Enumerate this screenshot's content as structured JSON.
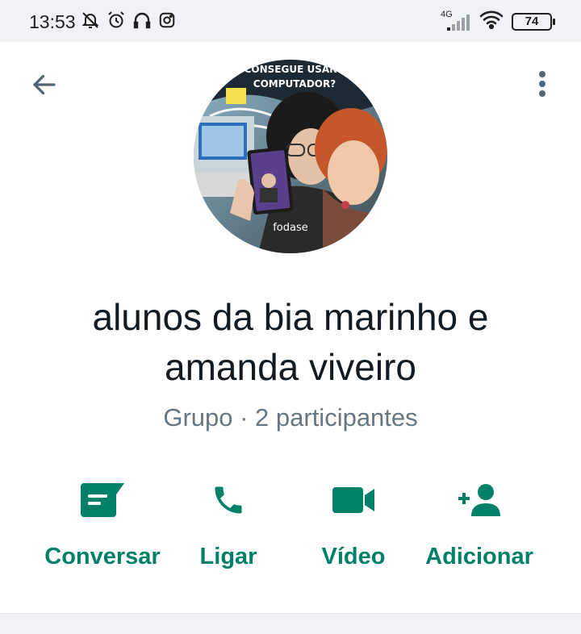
{
  "status_bar": {
    "time": "13:53",
    "network": "4G",
    "battery": "74",
    "left_icons": [
      "bell-off-icon",
      "alarm-icon",
      "headphones-icon",
      "instagram-icon"
    ],
    "right_icons": [
      "signal-icon",
      "wifi-icon",
      "battery-icon"
    ]
  },
  "header": {
    "back_icon": "arrow-left-icon",
    "menu_icon": "more-vertical-icon"
  },
  "avatar": {
    "caption_top": "CONSEGUE USAR\nCOMPUTADOR?",
    "caption_bottom": "fodase"
  },
  "group": {
    "name": "alunos da bia marinho e amanda viveiro",
    "subtitle": "Grupo · 2 participantes"
  },
  "actions": [
    {
      "label": "Conversar",
      "icon": "message-icon"
    },
    {
      "label": "Ligar",
      "icon": "phone-icon"
    },
    {
      "label": "Vídeo",
      "icon": "video-icon"
    },
    {
      "label": "Adicionar",
      "icon": "add-person-icon"
    }
  ],
  "colors": {
    "accent": "#008069",
    "subtitle": "#667781",
    "status_bg": "#f0f2f5"
  }
}
